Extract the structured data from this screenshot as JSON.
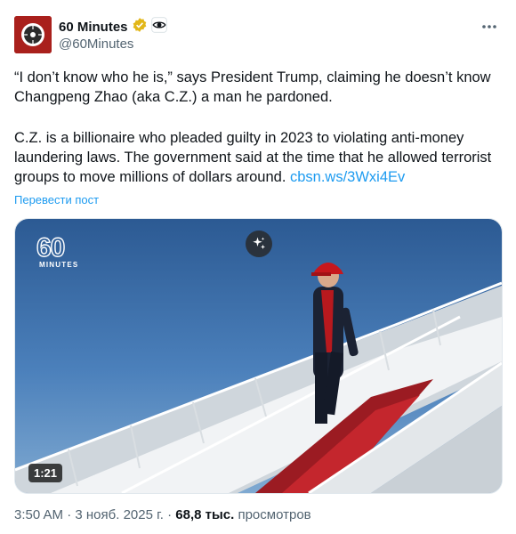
{
  "author": {
    "name": "60 Minutes",
    "handle": "@60Minutes",
    "verified_badge_color": "#e2b719",
    "affiliate_icon": "cbs-eye-icon"
  },
  "tweet": {
    "paragraph1": "“I don’t know who he is,” says President Trump, claiming he doesn’t know Changpeng Zhao (aka C.Z.) a man he pardoned.",
    "paragraph2_text": "C.Z. is a billionaire who pleaded guilty in 2023 to violating anti-money laundering laws. The government said at the time that he allowed terrorist groups to move millions of dollars around.",
    "paragraph2_link": "cbsn.ws/3Wxi4Ev",
    "translate_label": "Перевести пост"
  },
  "media": {
    "logo_number": "60",
    "logo_sub": "MINUTES",
    "duration": "1:21",
    "grok_icon": "sparkle-icon"
  },
  "meta": {
    "time": "3:50 AM",
    "separator": "·",
    "date": "3 нояб. 2025 г.",
    "views_count": "68,8 тыс.",
    "views_label": "просмотров"
  },
  "colors": {
    "link": "#1d9bf0",
    "secondary_text": "#536471",
    "avatar_bg": "#a9201c"
  }
}
